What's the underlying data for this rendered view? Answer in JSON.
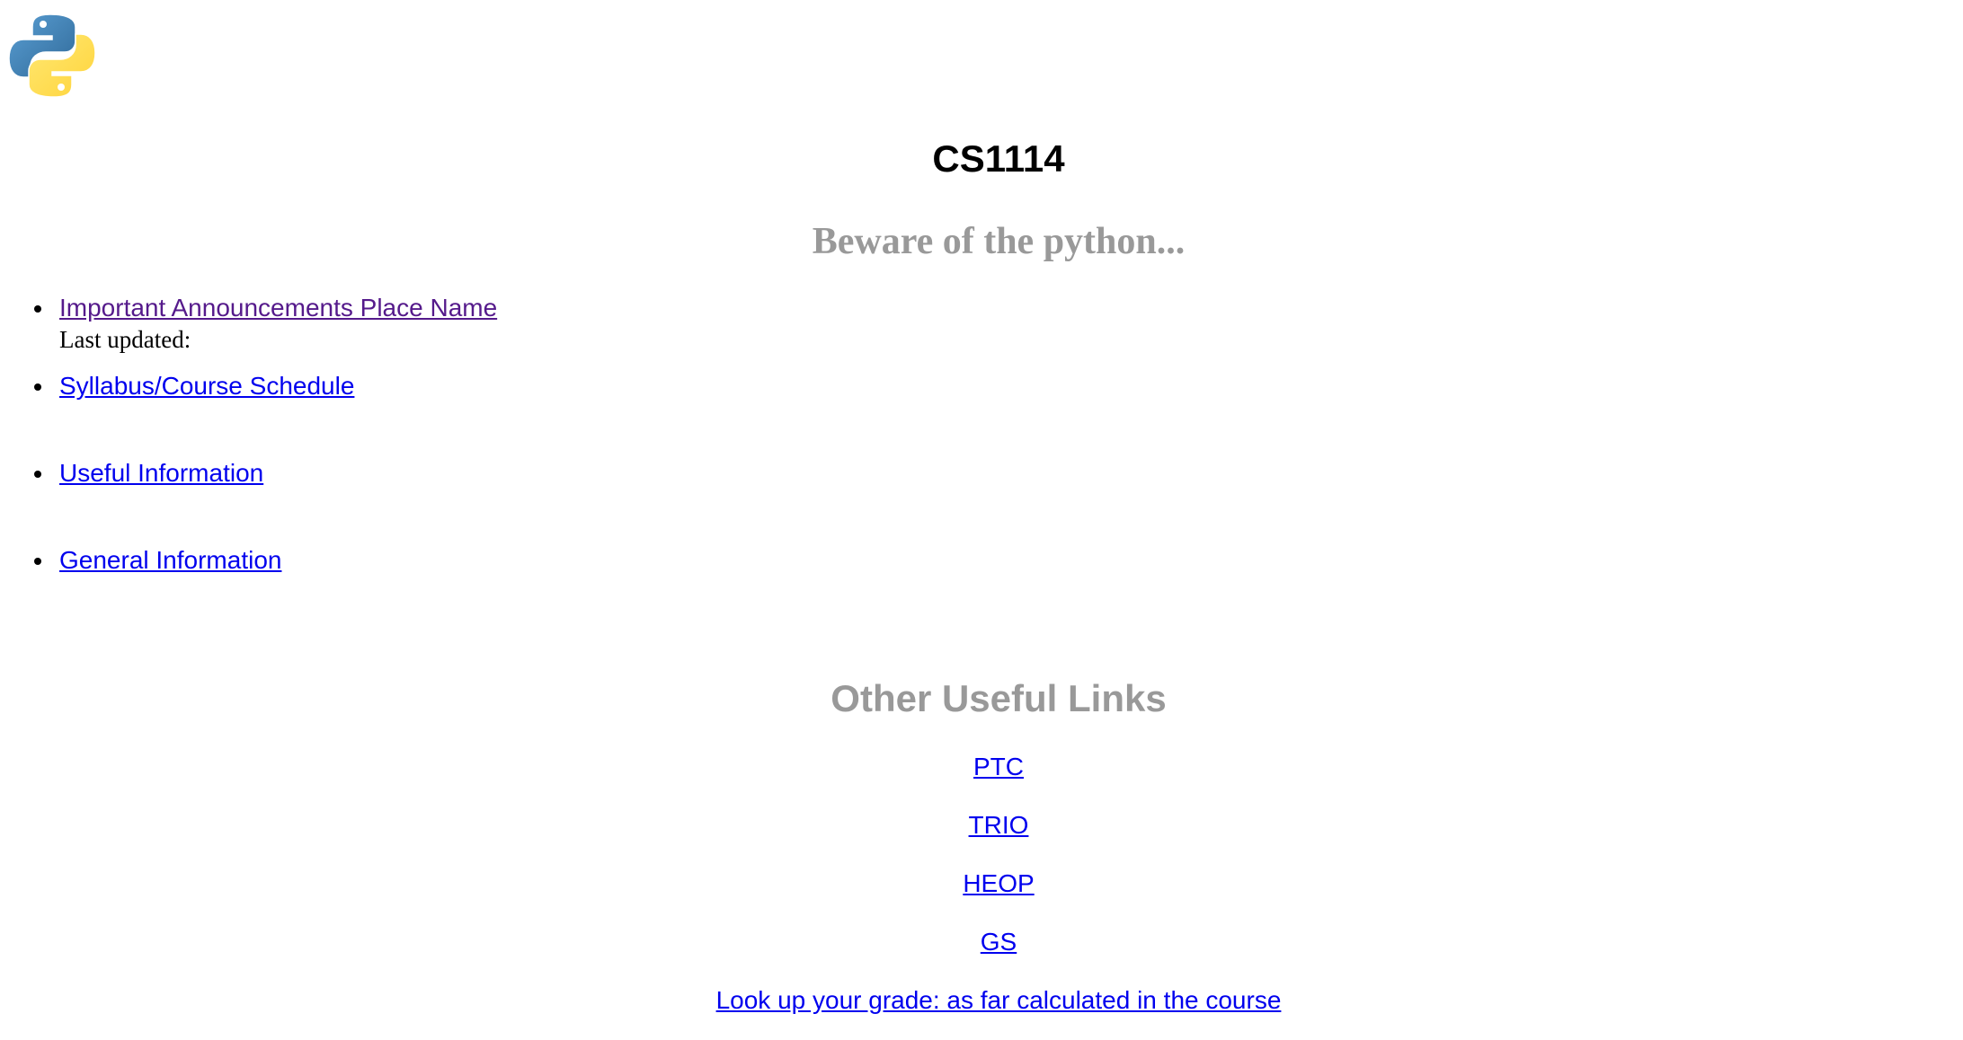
{
  "header": {
    "logo_icon": "python-logo-icon",
    "title": "CS1114",
    "subtitle": "Beware of the python..."
  },
  "main_links": [
    {
      "label": "Important Announcements Place Name",
      "visited": true,
      "note": "Last updated:"
    },
    {
      "label": "Syllabus/Course Schedule",
      "visited": false
    },
    {
      "label": "Useful Information",
      "visited": false
    },
    {
      "label": "General Information",
      "visited": false
    }
  ],
  "other_links": {
    "heading": "Other Useful Links",
    "items": [
      {
        "label": "PTC"
      },
      {
        "label": "TRIO"
      },
      {
        "label": "HEOP"
      },
      {
        "label": "GS"
      },
      {
        "label": "Look up your grade: as far calculated in the course"
      }
    ]
  },
  "colors": {
    "link": "#0000ee",
    "visited_link": "#551a8b",
    "heading_gray": "#999999",
    "python_blue": "#3a75a8",
    "python_yellow": "#ffd43b"
  }
}
